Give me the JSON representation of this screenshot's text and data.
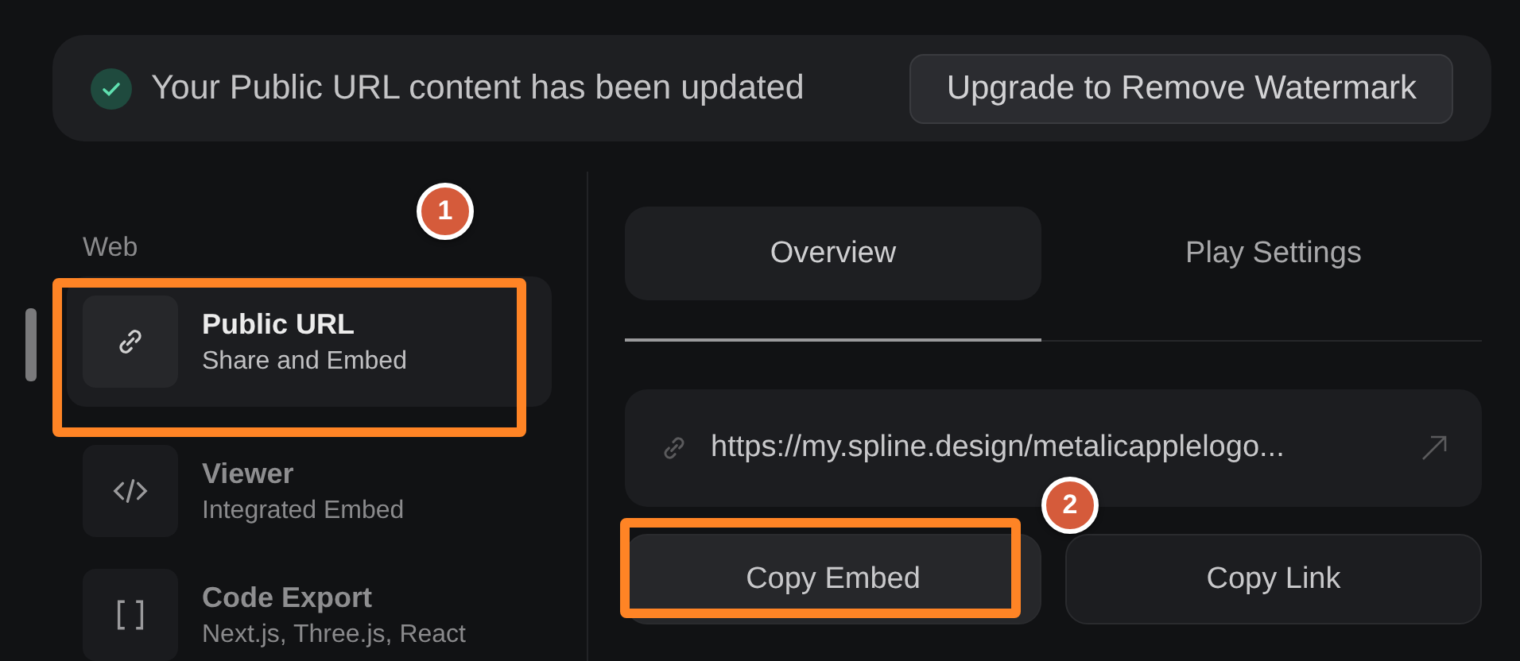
{
  "toast": {
    "message": "Your Public URL content has been updated",
    "button": "Upgrade to Remove Watermark"
  },
  "sidebar": {
    "section": "Web",
    "items": [
      {
        "kind": "link",
        "title": "Public URL",
        "subtitle": "Share and Embed",
        "selected": true,
        "highlighted": true
      },
      {
        "kind": "code",
        "title": "Viewer",
        "subtitle": "Integrated Embed",
        "selected": false,
        "highlighted": false
      },
      {
        "kind": "brackets",
        "title": "Code Export",
        "subtitle": "Next.js, Three.js, React",
        "selected": false,
        "highlighted": false
      }
    ]
  },
  "tabs": [
    {
      "label": "Overview",
      "selected": true
    },
    {
      "label": "Play Settings",
      "selected": false
    }
  ],
  "url_field": {
    "value": "https://my.spline.design/metalicapplelogo..."
  },
  "buttons": [
    {
      "label": "Copy Embed",
      "highlighted": true
    },
    {
      "label": "Copy Link",
      "highlighted": false
    }
  ],
  "markers": [
    "1",
    "2"
  ]
}
